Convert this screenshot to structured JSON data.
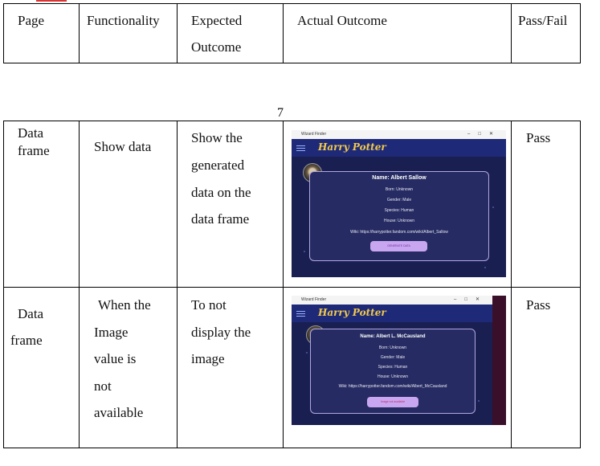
{
  "table": {
    "headers": [
      "Page",
      "Functionality",
      "Expected\nOutcome",
      "Actual Outcome",
      "Pass/Fail"
    ],
    "header_expected_lines": [
      "Expected",
      "Outcome"
    ],
    "page_number": "7",
    "rows": [
      {
        "page_lines": [
          "Data",
          "frame"
        ],
        "functionality_lines": [
          "Show data"
        ],
        "expected_lines": [
          "Show the",
          "generated",
          "data on the",
          "data frame"
        ],
        "result": "Pass",
        "screenshot": {
          "window_title": "Wizard Finder",
          "logo": "Harry Potter",
          "name": "Name: Albert Sallow",
          "born": "Born: Unknown",
          "gender": "Gender: Male",
          "species": "Species: Human",
          "house": "House: Unknown",
          "wiki": "Wiki: https://harrypotter.fandom.com/wiki/Albert_Sallow",
          "button": "GENERATE DATA"
        }
      },
      {
        "page_lines": [
          "Data",
          "frame"
        ],
        "functionality_lines": [
          "When the",
          "Image",
          "value is",
          "not",
          "available"
        ],
        "expected_lines": [
          "To not",
          "display the",
          "image"
        ],
        "result": "Pass",
        "screenshot": {
          "window_title": "Wizard Finder",
          "logo": "Harry Potter",
          "name": "Name: Albert L. McCausland",
          "born": "Born: Unknown",
          "gender": "Gender: Male",
          "species": "Species: Human",
          "house": "House: Unknown",
          "wiki": "Wiki: https://harrypotter.fandom.com/wiki/Albert_McCausland",
          "button": "Image not available"
        }
      }
    ]
  }
}
